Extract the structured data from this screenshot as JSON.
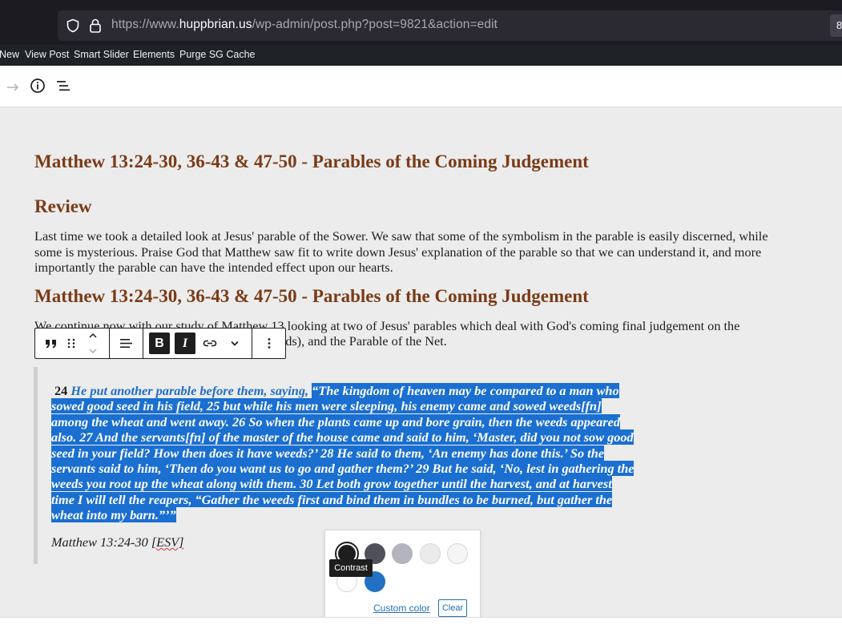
{
  "browser": {
    "url_prefix": "https://www.",
    "url_host": "huppbrian.us",
    "url_path": "/wp-admin/post.php?post=9821&action=edit",
    "right_chip": "8"
  },
  "adminbar": {
    "items": [
      "New",
      "View Post",
      "Smart Slider",
      "Elements",
      "Purge SG Cache"
    ]
  },
  "editor_header": {
    "icons": [
      "redo-icon",
      "info-icon",
      "list-view-icon"
    ]
  },
  "content": {
    "heading1": "Matthew 13:24-30, 36-43 & 47-50 - Parables of the Coming Judgement",
    "heading2": "Review",
    "para1": "Last time we took a detailed look at Jesus' parable of the Sower. We saw that some of the symbolism in the parable is easily discerned, while some is mysterious. Praise God that Matthew saw fit to write down Jesus' explanation of the parable so that we can understand it, and more importantly the parable can have the intended effect upon our hearts.",
    "heading3": "Matthew 13:24-30, 36-43 & 47-50 - Parables of the Coming Judgement",
    "para2_line1": "We continue now with our study of Matthew 13 looking at two  of Jesus' parables which deal with God's coming final judgement on the",
    "para2_line2": "weeds), and the Parable of the Net.",
    "quote": {
      "num": "24",
      "blue": "He put another parable before them, saying,",
      "selected_lines": [
        "“The kingdom of heaven may be compared to a man who",
        "sowed good seed in his field, 25 but while his men were sleeping, his enemy came and sowed weeds[fn]",
        "among the wheat and went away. 26 So when the plants came up and bore grain, then the weeds appeared",
        "also. 27 And the servants[fn] of the master of the house came and said to him, ‘Master, did you not sow good",
        "seed in your field? How then does it have weeds?’ 28 He said to them, ‘An enemy has done this.’ So the",
        "servants said to him, ‘Then do you want us to go and gather them?’ 29 But he said, ‘No, lest in gathering the",
        "weeds you root up the wheat along with them. 30 Let both grow together until the harvest, and at harvest",
        "time I will tell the reapers, “Gather the weeds first and bind them in bundles to be burned, but gather the",
        "wheat into my barn.”’”"
      ]
    },
    "citation": "Matthew 13:24-30 ",
    "citation_link": "[ESV]"
  },
  "block_toolbar": {
    "bold_label": "B",
    "italic_label": "I"
  },
  "color_popover": {
    "swatches": [
      "#1e1e1e",
      "#50505a",
      "#b4b4bf",
      "#ebebeb",
      "#f5f5f5",
      "#ffffff",
      "#2271c5"
    ],
    "tooltip": "Contrast",
    "custom_color_label": "Custom color",
    "clear_label": "Clear"
  }
}
